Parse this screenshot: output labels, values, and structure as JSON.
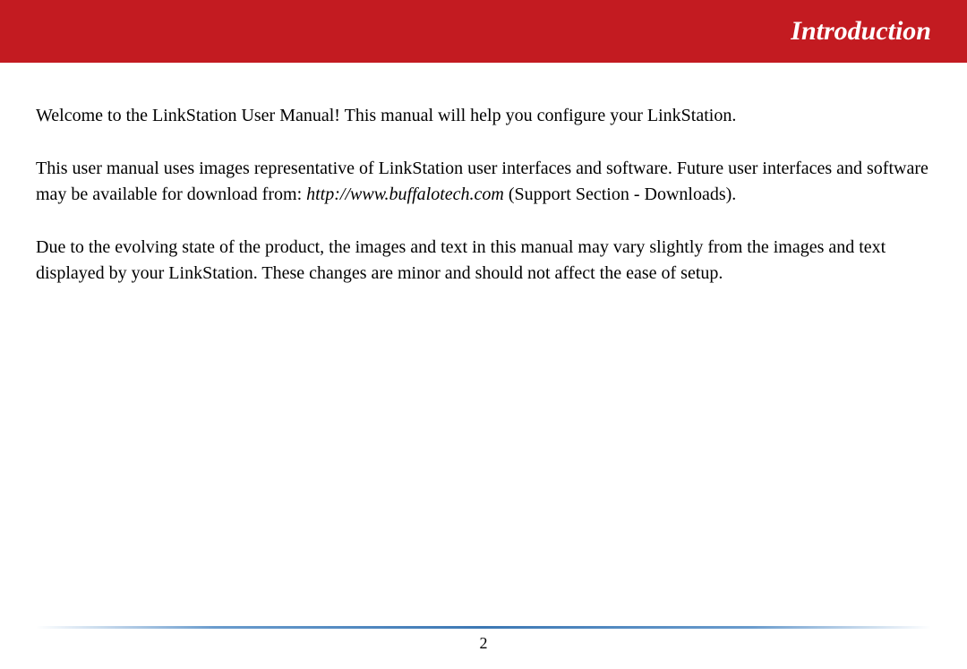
{
  "header": {
    "title": "Introduction"
  },
  "body": {
    "p1": "Welcome to the LinkStation User Manual!  This manual will help you configure your LinkStation.",
    "p2_a": "This user manual uses images representative of LinkStation user interfaces and software.  Future user interfaces and software may be available for download from:  ",
    "p2_url": "http://www.buffalotech.com",
    "p2_b": " (Support Section - Downloads).",
    "p3": "Due to the evolving state of the product, the images and text in this manual may vary slightly from the images and text displayed by your LinkStation.  These changes are minor and should not affect the ease of setup."
  },
  "footer": {
    "page_number": "2"
  }
}
